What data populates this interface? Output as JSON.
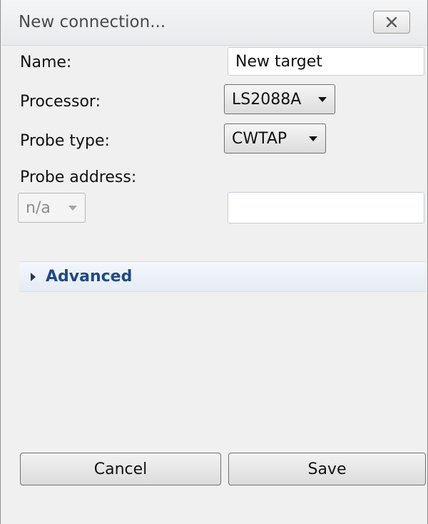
{
  "window": {
    "title": "New connection..."
  },
  "form": {
    "name": {
      "label": "Name:",
      "value": "New target"
    },
    "processor": {
      "label": "Processor:",
      "selected": "LS2088A"
    },
    "probe_type": {
      "label": "Probe type:",
      "selected": "CWTAP"
    },
    "probe_address": {
      "label": "Probe address:",
      "mode_selected": "n/a",
      "value": ""
    }
  },
  "advanced": {
    "label": "Advanced",
    "expanded": false
  },
  "buttons": {
    "cancel": "Cancel",
    "save": "Save"
  }
}
